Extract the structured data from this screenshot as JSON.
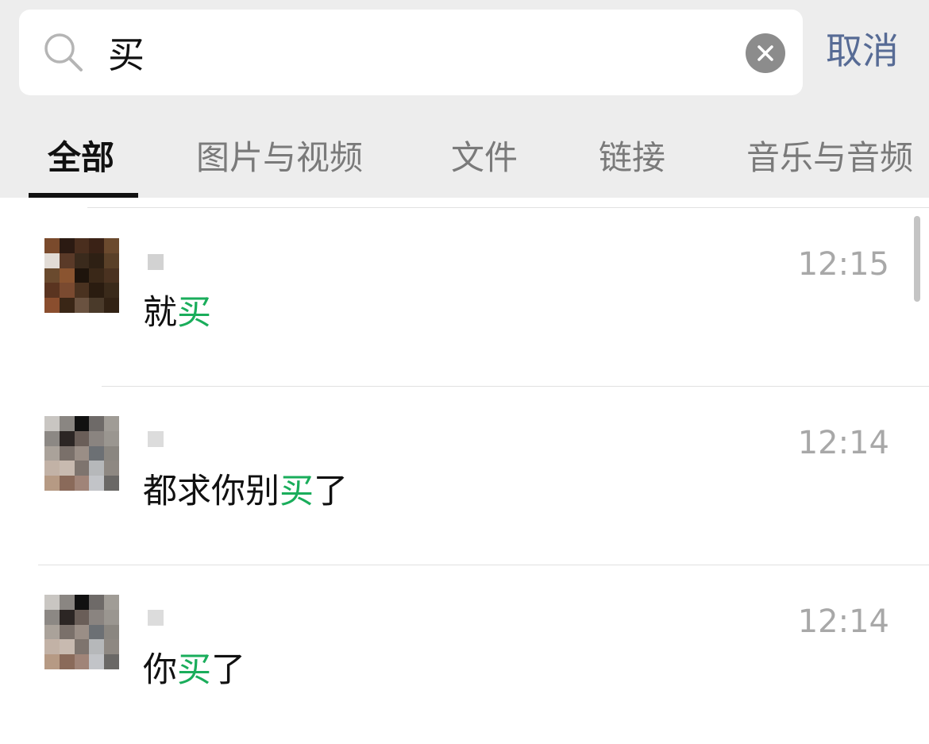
{
  "search": {
    "query": "买",
    "cancel_label": "取消"
  },
  "tabs": [
    {
      "label": "全部",
      "active": true
    },
    {
      "label": "图片与视频",
      "active": false
    },
    {
      "label": "文件",
      "active": false
    },
    {
      "label": "链接",
      "active": false
    },
    {
      "label": "音乐与音频",
      "active": false
    }
  ],
  "results": [
    {
      "time": "12:15",
      "message": {
        "before": "就",
        "match": "买",
        "after": ""
      }
    },
    {
      "time": "12:14",
      "message": {
        "before": "都求你别",
        "match": "买",
        "after": "了"
      }
    },
    {
      "time": "12:14",
      "message": {
        "before": "你",
        "match": "买",
        "after": "了"
      }
    }
  ],
  "colors": {
    "accent_link": "#576b95",
    "highlight": "#1aad5b",
    "header_bg": "#ededed"
  },
  "icons": [
    "search-icon",
    "clear-icon"
  ]
}
